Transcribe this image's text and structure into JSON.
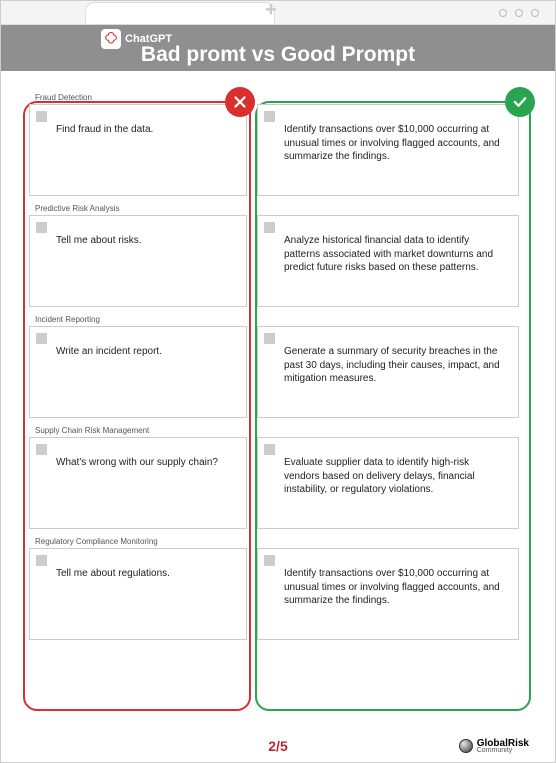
{
  "chrome": {
    "app_label": "ChatGPT"
  },
  "header": {
    "title": "Bad promt vs Good Prompt"
  },
  "sections": [
    {
      "label": "Fraud Detection",
      "bad": "Find fraud in the data.",
      "good": "Identify transactions over $10,000 occurring at unusual times or involving flagged accounts, and summarize the findings."
    },
    {
      "label": "Predictive Risk Analysis",
      "bad": "Tell me about risks.",
      "good": "Analyze historical financial data to identify patterns associated with market downturns and predict future risks based on these patterns."
    },
    {
      "label": "Incident Reporting",
      "bad": "Write an incident report.",
      "good": "Generate a summary of security breaches in the past 30 days, including their causes, impact, and mitigation measures."
    },
    {
      "label": "Supply Chain Risk Management",
      "bad": "What's wrong with our supply chain?",
      "good": "Evaluate supplier data to identify high-risk vendors based on delivery delays, financial instability, or regulatory violations."
    },
    {
      "label": "Regulatory Compliance Monitoring",
      "bad": "Tell me about regulations.",
      "good": "Identify transactions over $10,000 occurring at unusual times or involving flagged accounts, and summarize the findings."
    }
  ],
  "footer": {
    "page": "2/5",
    "brand_main": "GlobalRisk",
    "brand_sub": "Community"
  }
}
